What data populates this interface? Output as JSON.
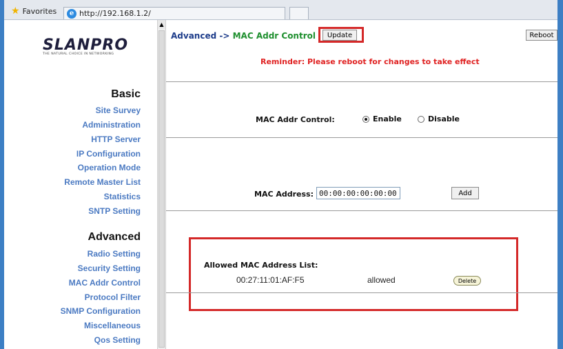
{
  "browser": {
    "favorites_label": "Favorites",
    "tab_url": "http://192.168.1.2/"
  },
  "logo": {
    "text": "SLANPRO",
    "tagline": "THE NATURAL CHOICE IN NETWORKING"
  },
  "sidebar": {
    "basic_title": "Basic",
    "basic_items": [
      "Site Survey",
      "Administration",
      "HTTP Server",
      "IP Configuration",
      "Operation Mode",
      "Remote Master List",
      "Statistics",
      "SNTP Setting"
    ],
    "advanced_title": "Advanced",
    "advanced_items": [
      "Radio Setting",
      "Security Setting",
      "MAC Addr Control",
      "Protocol Filter",
      "SNMP Configuration",
      "Miscellaneous",
      "Qos Setting"
    ]
  },
  "main": {
    "breadcrumb_section": "Advanced",
    "breadcrumb_arrow": "->",
    "breadcrumb_page": "MAC Addr Control",
    "update_label": "Update",
    "reboot_label": "Reboot",
    "reminder": "Reminder: Please reboot for changes to take effect",
    "mac_control_label": "MAC Addr Control:",
    "enable_label": "Enable",
    "disable_label": "Disable",
    "mac_control_selected": "Enable",
    "mac_address_label": "MAC Address:",
    "mac_address_value": "00:00:00:00:00:00",
    "add_label": "Add",
    "allowed_list_title": "Allowed MAC Address List:",
    "allowed_entries": [
      {
        "mac": "00:27:11:01:AF:F5",
        "status": "allowed",
        "delete_label": "Delete"
      }
    ]
  },
  "colors": {
    "frame_blue": "#3d7fc4",
    "nav_link": "#4b7ac2",
    "breadcrumb_green": "#1e8f2e",
    "reminder_red": "#e02222",
    "highlight_red": "#d42828"
  }
}
